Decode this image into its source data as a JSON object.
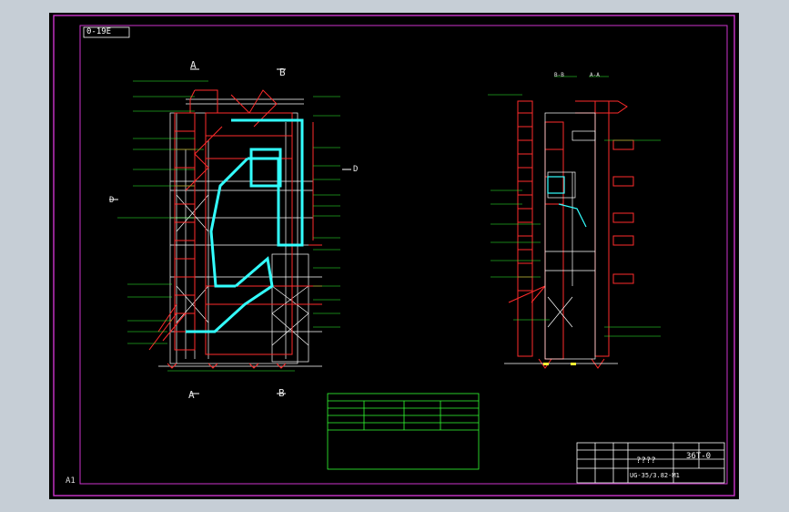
{
  "drawing": {
    "stamp": "0-19E",
    "sheet_size": "A1"
  },
  "section_marks": {
    "a_top": "A",
    "b_top": "B",
    "a_bottom": "A",
    "b_bottom": "B",
    "d_left": "D",
    "d_right": "D",
    "side_bb": "B-B",
    "side_aa": "A-A"
  },
  "title_block": {
    "title": "????",
    "code": "36T-0",
    "model": "UG-35/3.82-M1"
  },
  "colors": {
    "background": "#000000",
    "frame": "#cc33cc",
    "structure": "#ff2b2b",
    "steel": "#ffffff",
    "flue_path": "#33ffff",
    "annotation": "#33ff33",
    "window": "#c6ced6"
  }
}
